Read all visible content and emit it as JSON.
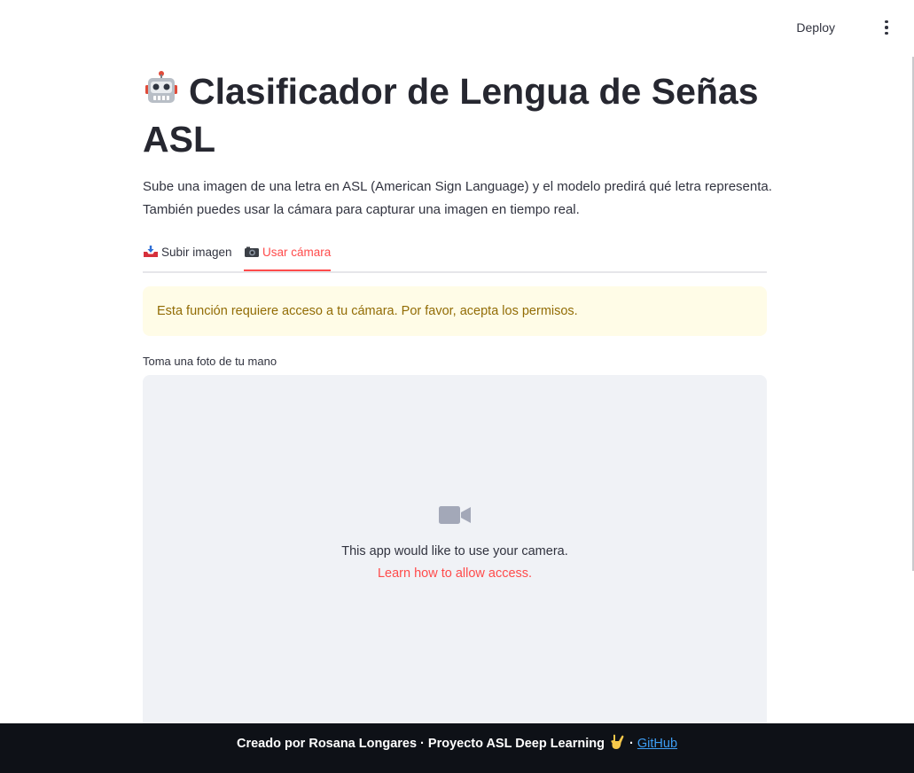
{
  "header": {
    "deploy_label": "Deploy",
    "menu_icon": "kebab-menu-icon"
  },
  "page": {
    "title": "Clasificador de Lengua de Señas ASL",
    "title_icon": "robot-icon",
    "description_line1": "Sube una imagen de una letra en ASL (American Sign Language) y el modelo predirá qué letra representa.",
    "description_line2": "También puedes usar la cámara para capturar una imagen en tiempo real."
  },
  "tabs": [
    {
      "label": "Subir imagen",
      "icon": "inbox-tray-icon",
      "selected": false
    },
    {
      "label": "Usar cámara",
      "icon": "camera-icon",
      "selected": true
    }
  ],
  "warning": {
    "text": "Esta función requiere acceso a tu cámara. Por favor, acepta los permisos."
  },
  "camera": {
    "label": "Toma una foto de tu mano",
    "icon": "video-camera-icon",
    "message": "This app would like to use your camera.",
    "link": "Learn how to allow access."
  },
  "footer": {
    "text": "Creado por Rosana Longares · Proyecto ASL Deep Learning",
    "icon": "sign-of-horns-icon",
    "separator": "·",
    "link": "GitHub"
  },
  "colors": {
    "accent": "#ff4b4b",
    "warning_bg": "#fffce7",
    "warning_text": "#926c05",
    "footer_bg": "#0e1117",
    "link_blue": "#3d9df3"
  }
}
